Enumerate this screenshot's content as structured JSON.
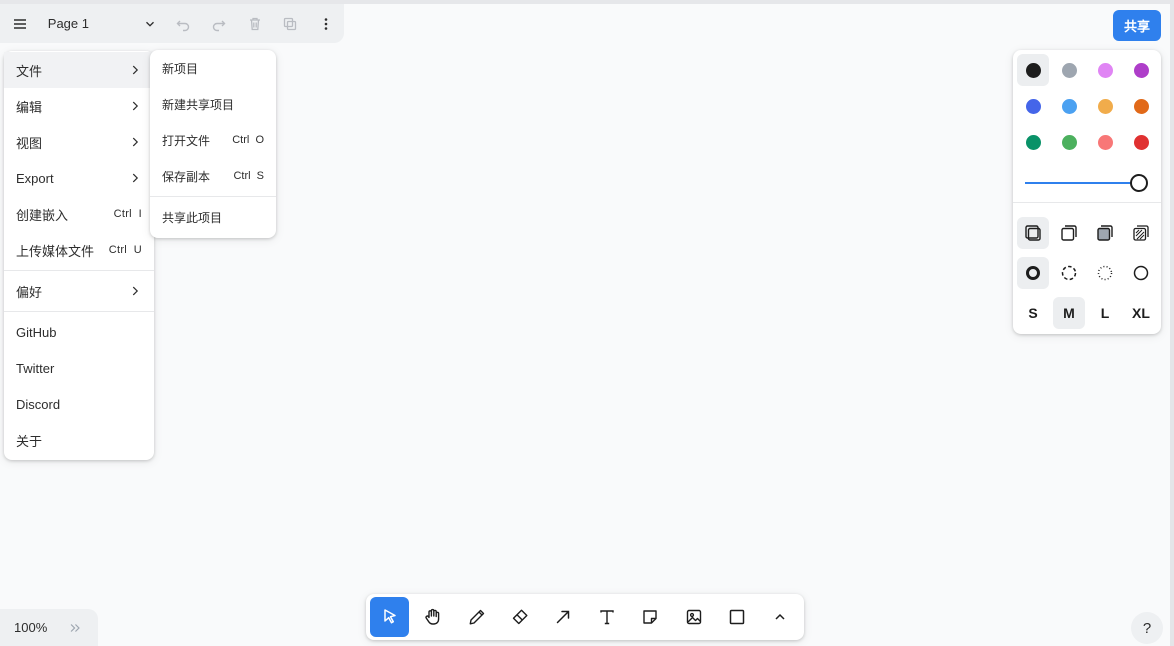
{
  "toolbar": {
    "page_name": "Page 1"
  },
  "main_menu": {
    "items": [
      {
        "label": "文件"
      },
      {
        "label": "编辑"
      },
      {
        "label": "视图"
      },
      {
        "label": "Export"
      },
      {
        "label": "创建嵌入",
        "shortcut": "Ctrl  I"
      },
      {
        "label": "上传媒体文件",
        "shortcut": "Ctrl  U"
      },
      {
        "label": "偏好"
      },
      {
        "label": "GitHub"
      },
      {
        "label": "Twitter"
      },
      {
        "label": "Discord"
      },
      {
        "label": "关于"
      }
    ]
  },
  "file_submenu": {
    "items": [
      {
        "label": "新项目"
      },
      {
        "label": "新建共享项目"
      },
      {
        "label": "打开文件",
        "shortcut": "Ctrl  O"
      },
      {
        "label": "保存副本",
        "shortcut": "Ctrl  S"
      },
      {
        "label": "共享此项目"
      }
    ]
  },
  "share_button": {
    "label": "共享"
  },
  "style_panel": {
    "colors": [
      "#1d1d1d",
      "#9ea6b0",
      "#e085f4",
      "#ae3ec9",
      "#4465e9",
      "#4ba1f1",
      "#f1ac4b",
      "#e16919",
      "#099268",
      "#4cb05e",
      "#f87777",
      "#e03131"
    ],
    "selected_color": "#1d1d1d",
    "opacity": 1.0,
    "sizes": [
      "S",
      "M",
      "L",
      "XL"
    ],
    "selected_size": "M"
  },
  "zoom": {
    "value": "100%"
  },
  "help": {
    "label": "?"
  }
}
